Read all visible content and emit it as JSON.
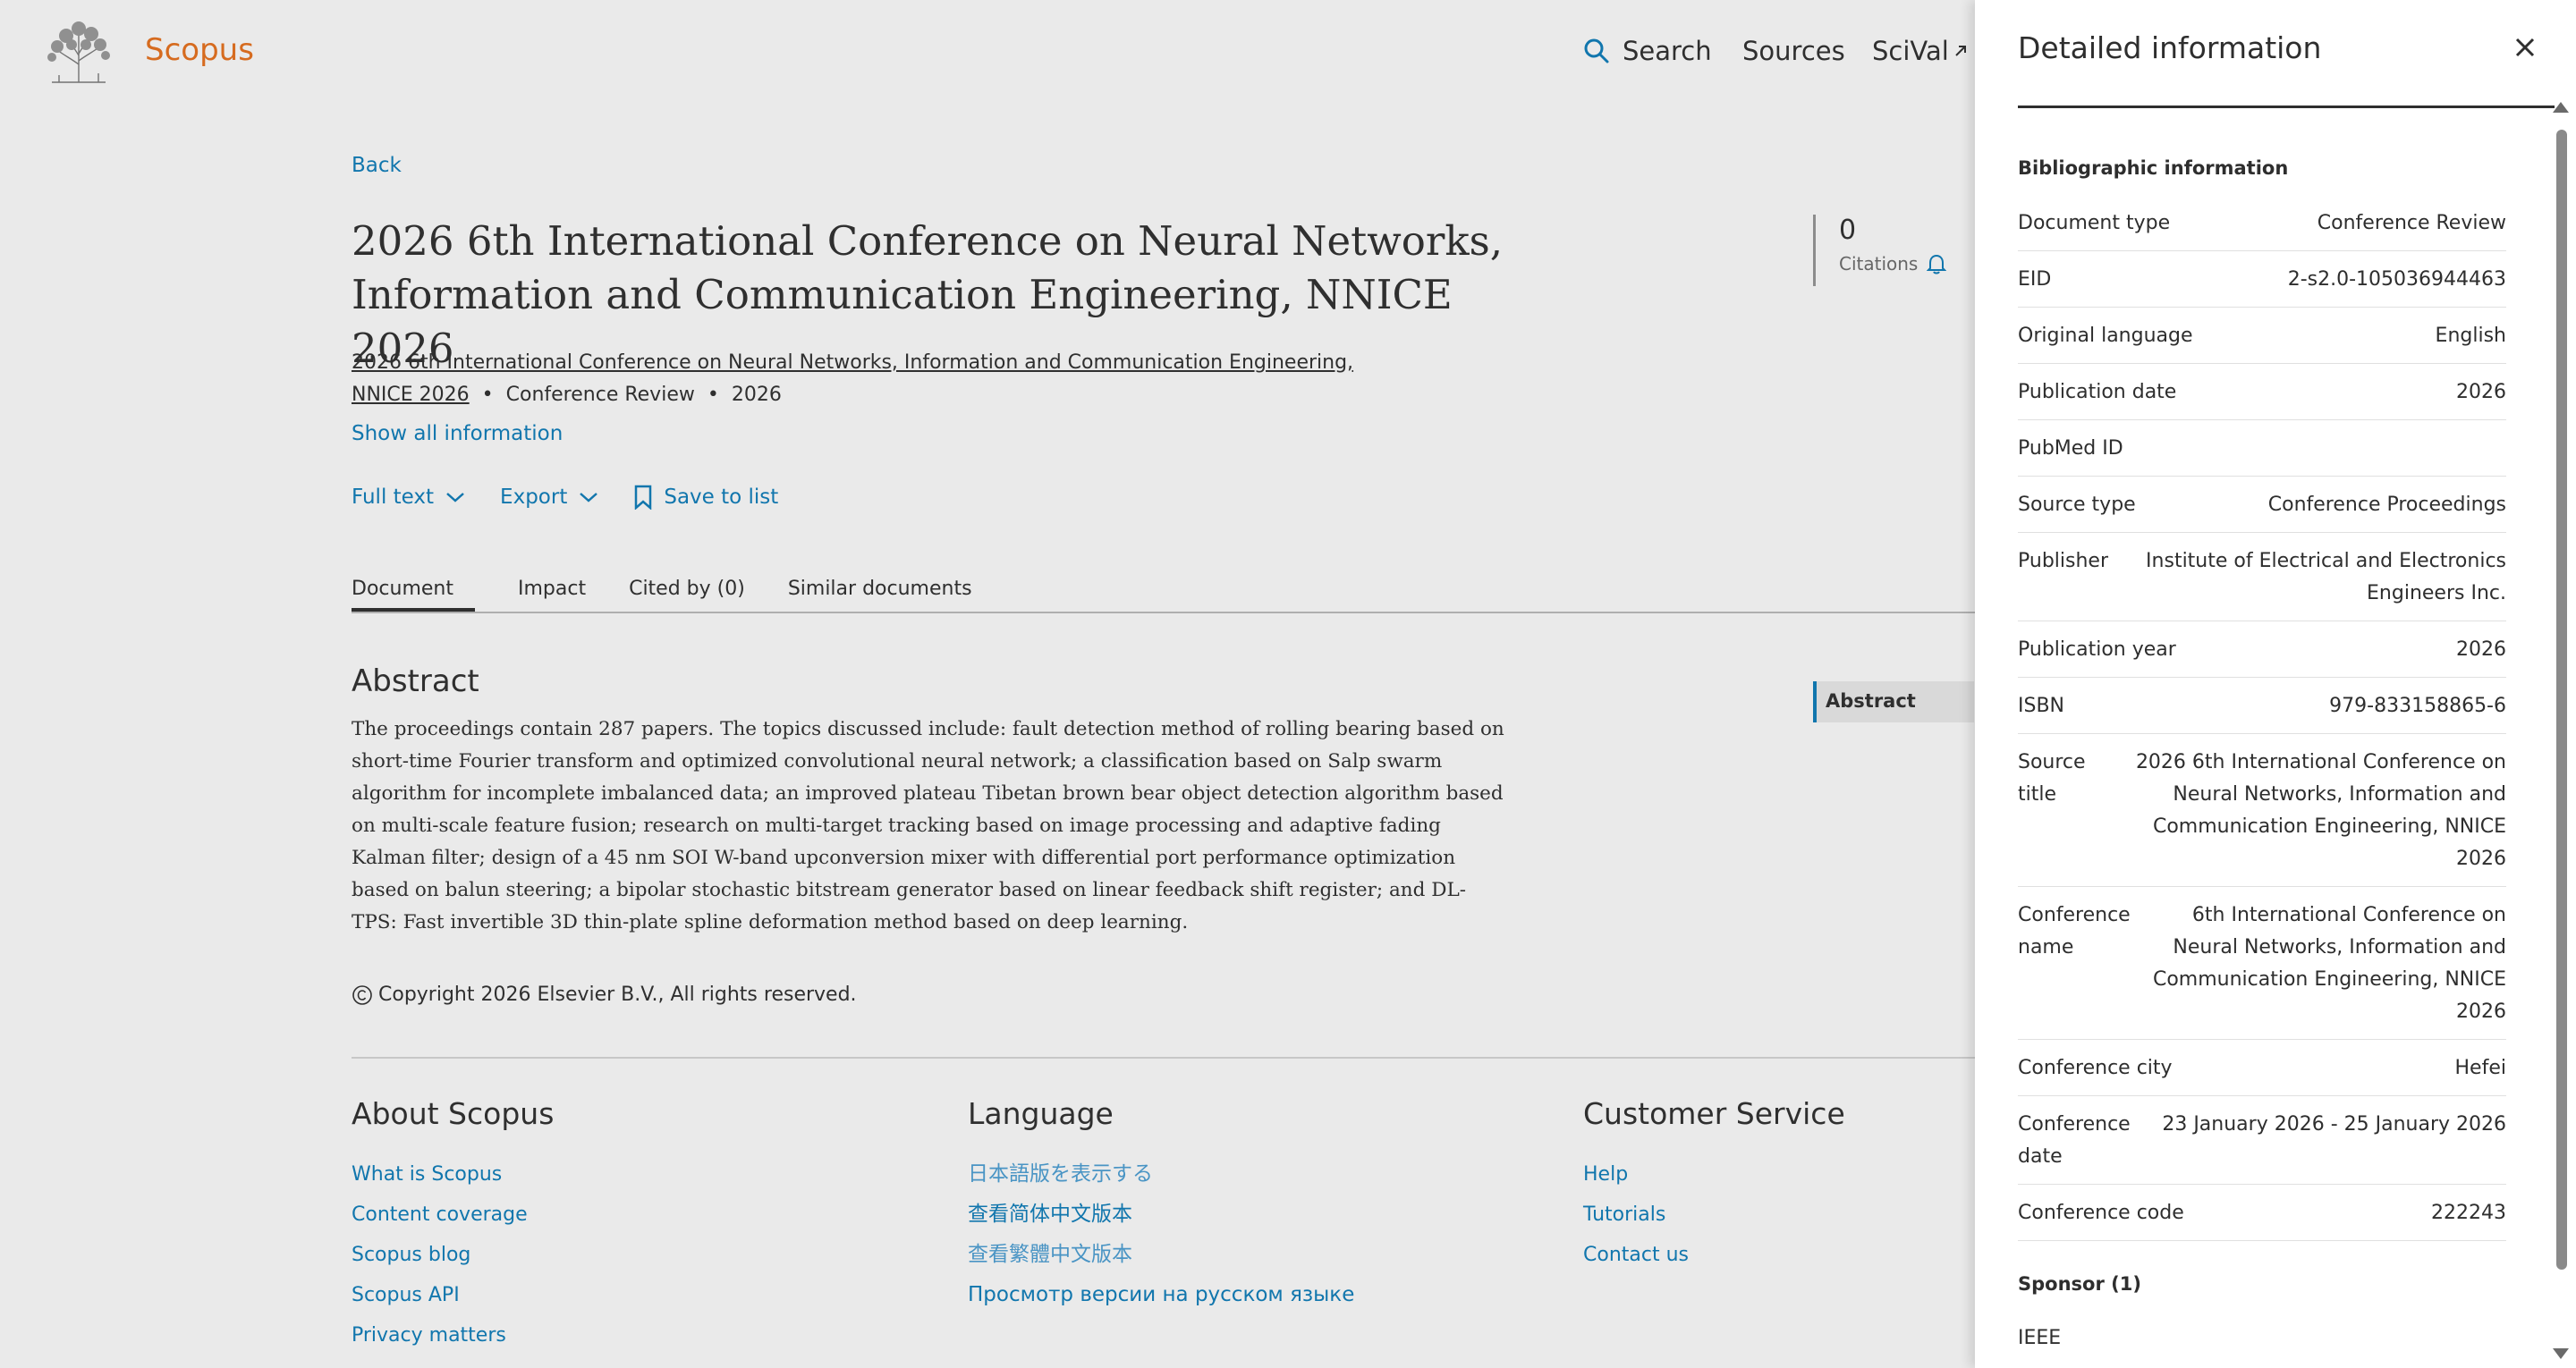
{
  "header": {
    "brand": "Scopus",
    "nav": {
      "search": "Search",
      "sources": "Sources",
      "scival": "SciVal"
    }
  },
  "document": {
    "back_label": "Back",
    "title": "2026 6th International Conference on Neural Networks, Information and Communication Engineering, NNICE 2026",
    "source_link": "2026 6th International Conference on Neural Networks, Information and Communication Engineering, NNICE 2026",
    "doc_type": "Conference Review",
    "year": "2026",
    "show_all": "Show all information",
    "actions": {
      "full_text": "Full text",
      "export": "Export",
      "save": "Save to list"
    },
    "citations": {
      "count": "0",
      "label": "Citations"
    },
    "tabs": [
      "Document",
      "Impact",
      "Cited by (0)",
      "Similar documents"
    ],
    "abstract_heading": "Abstract",
    "abstract_text": "The proceedings contain 287 papers. The topics discussed include: fault detection method of rolling bearing based on short-time Fourier transform and optimized convolutional neural network; a classification based on Salp swarm algorithm for incomplete imbalanced data; an improved plateau Tibetan brown bear object detection algorithm based on multi-scale feature fusion; research on multi-target tracking based on image processing and adaptive fading Kalman filter; design of a 45 nm SOI W-band upconversion mixer with differential port performance optimization based on balun steering; a bipolar stochastic bitstream generator based on linear feedback shift register; and DL-TPS: Fast invertible 3D thin-plate spline deformation method based on deep learning.",
    "toc_abstract": "Abstract",
    "copyright": "Copyright 2026 Elsevier B.V., All rights reserved."
  },
  "footer": {
    "about": {
      "heading": "About Scopus",
      "links": [
        "What is Scopus",
        "Content coverage",
        "Scopus blog",
        "Scopus API",
        "Privacy matters"
      ]
    },
    "language": {
      "heading": "Language",
      "links": [
        "日本語版を表示する",
        "查看简体中文版本",
        "查看繁體中文版本",
        "Просмотр версии на русском языке"
      ]
    },
    "customer": {
      "heading": "Customer Service",
      "links": [
        "Help",
        "Tutorials",
        "Contact us"
      ]
    }
  },
  "panel": {
    "title": "Detailed information",
    "bib_heading": "Bibliographic information",
    "rows": [
      {
        "key": "Document type",
        "value": "Conference Review"
      },
      {
        "key": "EID",
        "value": "2-s2.0-105036944463"
      },
      {
        "key": "Original language",
        "value": "English"
      },
      {
        "key": "Publication date",
        "value": "2026"
      },
      {
        "key": "PubMed ID",
        "value": ""
      },
      {
        "key": "Source type",
        "value": "Conference Proceedings"
      },
      {
        "key": "Publisher",
        "value": "Institute of Electrical and Electronics Engineers Inc."
      },
      {
        "key": "Publication year",
        "value": "2026"
      },
      {
        "key": "ISBN",
        "value": "979-833158865-6"
      },
      {
        "key": "Source title",
        "value": "2026 6th International Conference on Neural Networks, Information and Communication Engineering, NNICE 2026"
      },
      {
        "key": "Conference name",
        "value": "6th International Conference on Neural Networks, Information and Communication Engineering, NNICE 2026"
      },
      {
        "key": "Conference city",
        "value": "Hefei"
      },
      {
        "key": "Conference date",
        "value": "23 January 2026 - 25 January 2026"
      },
      {
        "key": "Conference code",
        "value": "222243"
      }
    ],
    "sponsor_heading": "Sponsor (1)",
    "sponsors": [
      "IEEE"
    ]
  },
  "colors": {
    "brand": "#e9711c",
    "link": "#0c7dbb",
    "text": "#2e2e2e"
  },
  "icons": [
    "elsevier-tree-logo",
    "search-icon",
    "external-link-icon",
    "chevron-down-icon",
    "bookmark-icon",
    "bell-icon",
    "copyright-icon",
    "close-icon"
  ]
}
